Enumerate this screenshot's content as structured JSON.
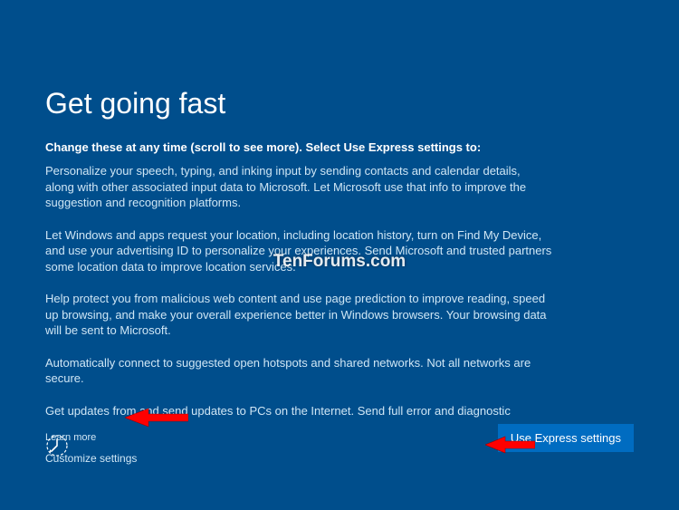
{
  "title": "Get going fast",
  "subtitle": "Change these at any time (scroll to see more). Select Use Express settings to:",
  "paragraphs": [
    "Personalize your speech, typing, and inking input by sending contacts and calendar details, along with other associated input data to Microsoft. Let Microsoft use that info to improve the suggestion and recognition platforms.",
    "Let Windows and apps request your location, including location history, turn on Find My Device, and use your advertising ID to personalize your experiences. Send Microsoft and trusted partners some location data to improve location services.",
    "Help protect you from malicious web content and use page prediction to improve reading, speed up browsing, and make your overall experience better in Windows browsers. Your browsing data will be sent to Microsoft.",
    "Automatically connect to suggested open hotspots and shared networks. Not all networks are secure.",
    "Get updates from and send updates to PCs on the Internet. Send full error and diagnostic"
  ],
  "learn_more": "Learn more",
  "customize": "Customize settings",
  "express_button": "Use Express settings",
  "watermark": "TenForums.com"
}
